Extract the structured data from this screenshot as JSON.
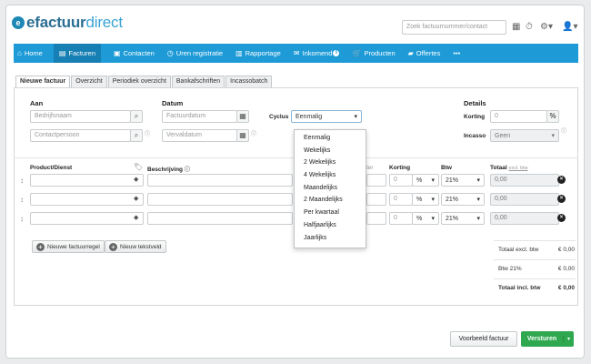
{
  "brand": {
    "mark": "e",
    "name_bold": "efactuur",
    "name_light": "direct"
  },
  "header": {
    "search_placeholder": "Zoek factuurnummer/contact",
    "icons": [
      "calculator-icon",
      "clock-icon",
      "settings-icon",
      "user-icon"
    ]
  },
  "nav": {
    "items": [
      {
        "label": "Home",
        "icon": "home-icon"
      },
      {
        "label": "Facturen",
        "icon": "invoice-icon"
      },
      {
        "label": "Contacten",
        "icon": "contacts-icon"
      },
      {
        "label": "Uren registratie",
        "icon": "clock-icon"
      },
      {
        "label": "Rapportage",
        "icon": "chart-icon"
      },
      {
        "label": "Inkomend",
        "icon": "inbox-icon",
        "badge": "8"
      },
      {
        "label": "Producten",
        "icon": "cart-icon"
      },
      {
        "label": "Offertes",
        "icon": "folder-icon"
      },
      {
        "label": "•••",
        "icon": ""
      }
    ],
    "active": "Facturen",
    "color": "#1e9bd7"
  },
  "tabs": [
    "Nieuwe factuur",
    "Overzicht",
    "Periodiek overzicht",
    "Bankafschriften",
    "Incassobatch"
  ],
  "form": {
    "aan_label": "Aan",
    "company_placeholder": "Bedrijfsnaam",
    "contact_placeholder": "Contactpersoon",
    "datum_label": "Datum",
    "invoice_date_placeholder": "Factuurdatum",
    "due_date_placeholder": "Vervaldatum",
    "cyclus_label": "Cyclus",
    "cyclus_value": "Eenmalig",
    "cyclus_options": [
      "Eenmalig",
      "Wekelijks",
      "2 Wekelijks",
      "4 Wekelijks",
      "Maandelijks",
      "2 Maandelijks",
      "Per kwartaal",
      "Halfjaarlijks",
      "Jaarlijks"
    ],
    "details_label": "Details",
    "korting_label": "Korting",
    "korting_placeholder": "0",
    "korting_unit": "%",
    "incasso_label": "Incasso",
    "incasso_value": "Geen"
  },
  "lines": {
    "headers": {
      "product": "Product/Dienst",
      "beschrijving": "Beschrijving",
      "prijs_partial": "ter",
      "korting": "Korting",
      "btw": "Btw",
      "totaal": "Totaal",
      "totaal_sub": "excl. btw"
    },
    "rows": [
      {
        "korting": "0",
        "korting_unit": "%",
        "btw": "21%",
        "totaal": "0,00"
      },
      {
        "korting": "0",
        "korting_unit": "%",
        "btw": "21%",
        "totaal": "0,00"
      },
      {
        "korting": "0",
        "korting_unit": "%",
        "btw": "21%",
        "totaal": "0,00"
      }
    ],
    "add_line_label": "Nieuwe factuurregel",
    "add_text_label": "Nieuw tekstveld"
  },
  "totals": [
    {
      "label": "Totaal excl. btw",
      "value": "€ 0,00"
    },
    {
      "label": "Btw 21%",
      "value": "€ 0,00"
    },
    {
      "label": "Totaal incl. btw",
      "value": "€ 0,00"
    }
  ],
  "actions": {
    "preview_label": "Voorbeeld factuur",
    "send_label": "Versturen",
    "send_color": "#2fa84f"
  }
}
